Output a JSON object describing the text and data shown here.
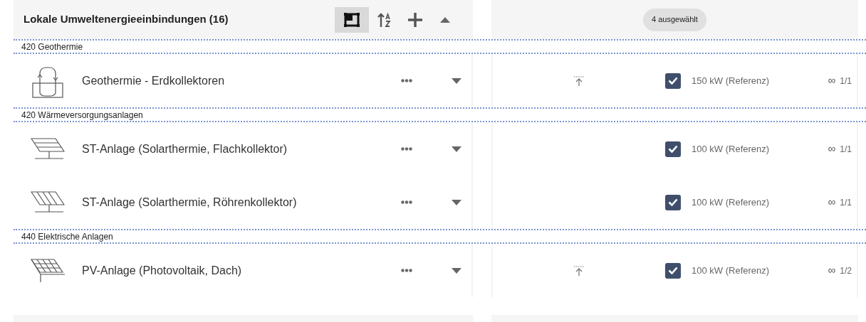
{
  "panel": {
    "title": "Lokale Umweltenergieeinbindungen (16)",
    "toolbar": [
      {
        "kind": "frame",
        "selected": true
      },
      {
        "kind": "sort",
        "selected": false
      },
      {
        "kind": "add",
        "selected": false
      },
      {
        "kind": "collapse",
        "selected": false
      }
    ]
  },
  "selection_badge": "4 ausgewählt",
  "groups": [
    {
      "title": "420 Geothermie",
      "items": [
        {
          "kind": "loop",
          "name": "Geothermie - Erdkollektoren",
          "marker": true,
          "checked": true,
          "power": "150 kW (Referenz)",
          "link_symbol": "∞",
          "count": "1/1"
        }
      ]
    },
    {
      "title": "420 Wärmeversorgungsanlagen",
      "items": [
        {
          "kind": "flat",
          "name": "ST-Anlage (Solarthermie, Flachkollektor)",
          "marker": false,
          "checked": true,
          "power": "100 kW (Referenz)",
          "link_symbol": "∞",
          "count": "1/1"
        },
        {
          "kind": "tube",
          "name": "ST-Anlage (Solarthermie, Röhrenkollektor)",
          "marker": false,
          "checked": true,
          "power": "100 kW (Referenz)",
          "link_symbol": "∞",
          "count": "1/1"
        }
      ]
    },
    {
      "title": "440 Elektrische Anlagen",
      "items": [
        {
          "kind": "pv",
          "name": "PV-Anlage (Photovoltaik, Dach)",
          "marker": true,
          "checked": true,
          "power": "100 kW (Referenz)",
          "link_symbol": "∞",
          "count": "1/2"
        }
      ]
    }
  ]
}
